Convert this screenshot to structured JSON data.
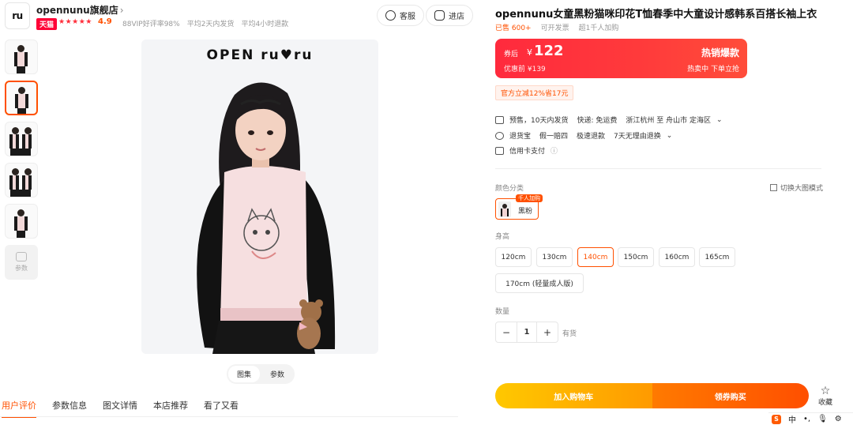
{
  "store": {
    "logo_text": "ru",
    "name": "opennunu旗舰店",
    "name_chevron": "›",
    "platform_badge": "天猫",
    "stars": "★★★★★",
    "rating": "4.9",
    "stats": [
      "88VIP好评率98%",
      "平均2天内发货",
      "平均4小时退款"
    ],
    "service_button": "客服",
    "enter_button": "进店"
  },
  "gallery": {
    "brand_title": "OPEN ru♥ru",
    "more_label": "参数",
    "view_tabs": [
      "图集",
      "参数"
    ]
  },
  "bottom_tabs": [
    "用户评价",
    "参数信息",
    "图文详情",
    "本店推荐",
    "看了又看"
  ],
  "product": {
    "title": "opennunu女童黑粉猫咪印花T恤春季中大童设计感韩系百搭长袖上衣",
    "sold": "已售 600+",
    "meta_2": "可开发票",
    "meta_3": "超1千人加购",
    "price": {
      "coupon_tag": "券后",
      "currency": "¥",
      "amount": "122",
      "original": "优惠前 ¥139",
      "hot_label": "热销爆款",
      "hot_sub": "热卖中  下单立抢"
    },
    "coupon": "官方立减12%省17元",
    "shipping": {
      "presale": "预售，10天内发货",
      "delivery": "快递: 免运费",
      "route": "浙江杭州 至 舟山市 定海区",
      "route_chevron": "⌄"
    },
    "services": {
      "refund": "退货宝",
      "compensate": "假一赔四",
      "fast_refund": "极速退款",
      "no_reason": "7天无理由退换",
      "chevron": "⌄"
    },
    "payment": "信用卡支付",
    "payment_info": "ⓘ"
  },
  "options": {
    "color_label": "颜色分类",
    "switch_mode": "切换大图模式",
    "color_badge": "千人加购",
    "color_name": "黑粉",
    "height_label": "身高",
    "sizes": [
      "120cm",
      "130cm",
      "140cm",
      "150cm",
      "160cm",
      "165cm",
      "170cm  (轻量成人版)"
    ],
    "selected_size": "140cm",
    "quantity_label": "数量",
    "quantity": "1",
    "minus": "−",
    "plus": "+",
    "stock": "有货"
  },
  "actions": {
    "add_cart": "加入购物车",
    "buy_now": "领券购买",
    "favorite": "收藏",
    "favorite_icon": "☆"
  },
  "tray": {
    "ime_badge": "S",
    "ime_lang": "中",
    "punct": "•,",
    "mic": "🎙",
    "gear": "⚙"
  },
  "colors": {
    "accent": "#ff5000",
    "price_red": "#ff2a3d",
    "cart_yellow": "#ffc800"
  }
}
